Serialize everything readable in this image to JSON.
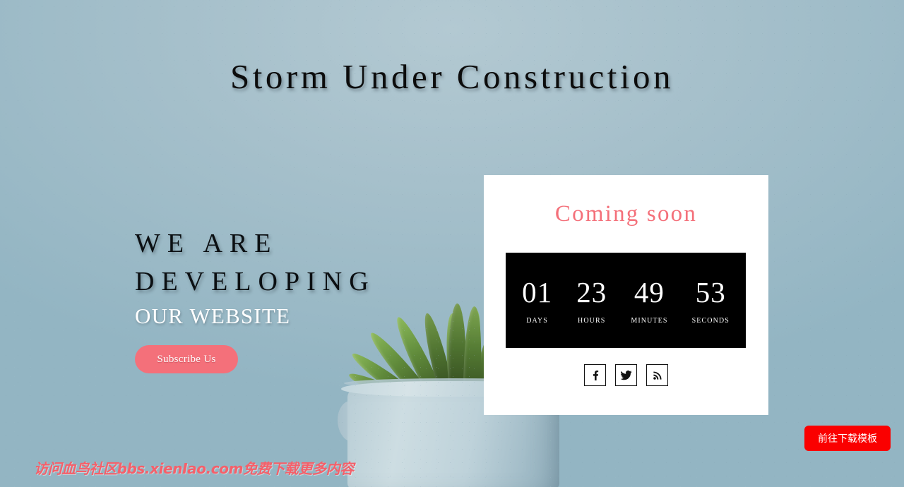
{
  "page": {
    "title": "Storm Under Construction",
    "background_color": "#95b7c4"
  },
  "hero": {
    "line1": "WE ARE",
    "line2": "DEVELOPING",
    "line3": "OUR WEBSITE",
    "subscribe_label": "Subscribe Us",
    "accent_color": "#f4707a"
  },
  "card": {
    "coming_soon": "Coming soon",
    "countdown": {
      "background_color": "#000000",
      "units": [
        {
          "value": "01",
          "label": "Days"
        },
        {
          "value": "23",
          "label": "Hours"
        },
        {
          "value": "49",
          "label": "Minutes"
        },
        {
          "value": "53",
          "label": "Seconds"
        }
      ]
    },
    "socials": [
      {
        "name": "facebook-icon",
        "title": "Facebook"
      },
      {
        "name": "twitter-icon",
        "title": "Twitter"
      },
      {
        "name": "rss-icon",
        "title": "RSS"
      }
    ]
  },
  "watermark": {
    "text": "访问血鸟社区bbs.xienIao.com免费下载更多内容",
    "color": "#f4606a"
  },
  "download": {
    "label": "前往下载模板",
    "color": "#fa0000"
  }
}
